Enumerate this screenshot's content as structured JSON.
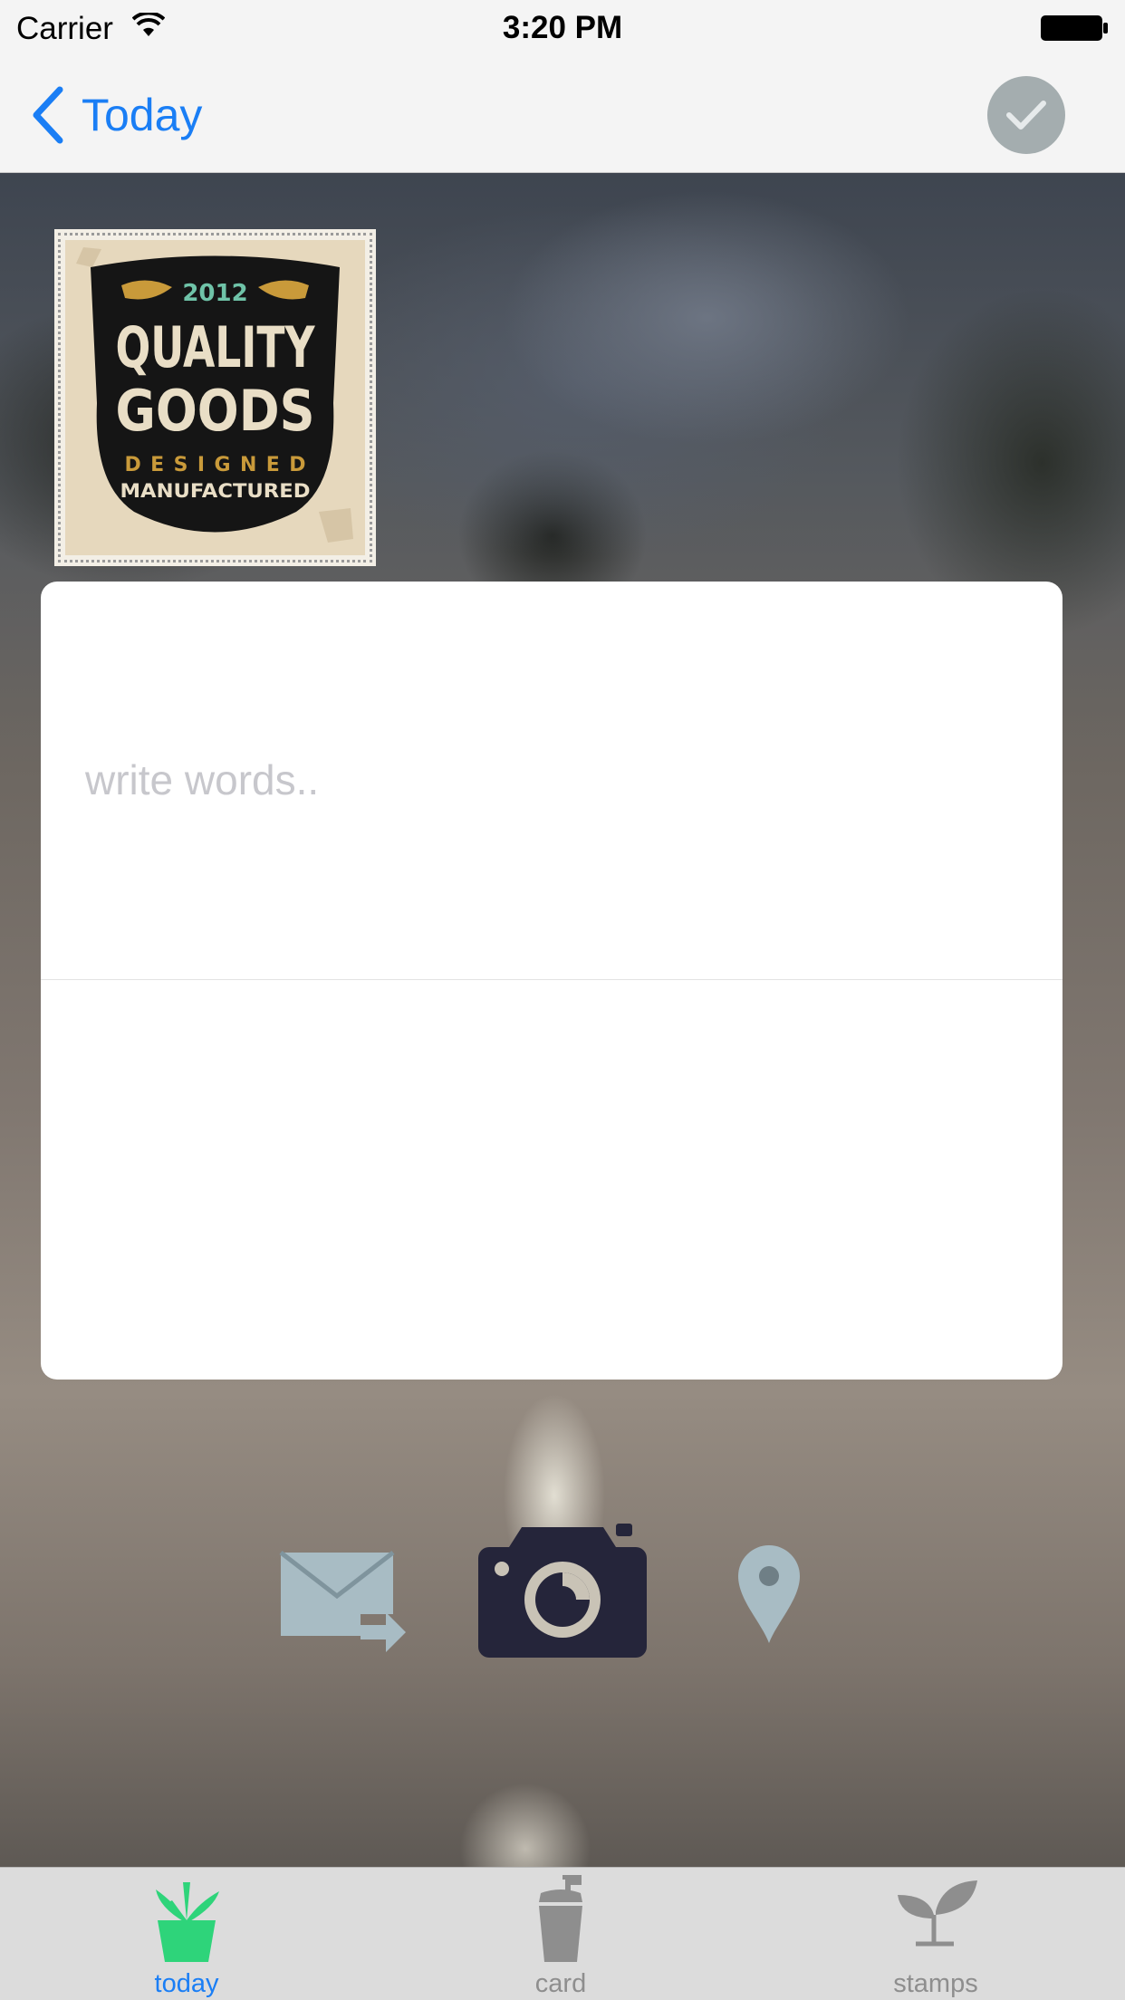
{
  "status_bar": {
    "carrier": "Carrier",
    "time": "3:20 PM"
  },
  "nav": {
    "back_label": "Today",
    "done_icon": "checkmark-icon"
  },
  "stamp": {
    "year": "2012",
    "line1": "QUALITY",
    "line2": "GOODS",
    "line3": "DESIGNED",
    "line4": "MANUFACTURED"
  },
  "card": {
    "placeholder": "write words.."
  },
  "actions": [
    {
      "icon": "mail-forward-icon"
    },
    {
      "icon": "camera-icon"
    },
    {
      "icon": "location-pin-icon"
    }
  ],
  "tabs": [
    {
      "label": "today",
      "icon": "plant-icon",
      "selected": true
    },
    {
      "label": "card",
      "icon": "cup-icon"
    },
    {
      "label": "stamps",
      "icon": "sprout-icon"
    }
  ],
  "colors": {
    "accent": "#1a7ef5",
    "selected_tab_icon": "#2ed47a",
    "camera": "#25253a",
    "icon_inactive": "#a8bcc4"
  }
}
